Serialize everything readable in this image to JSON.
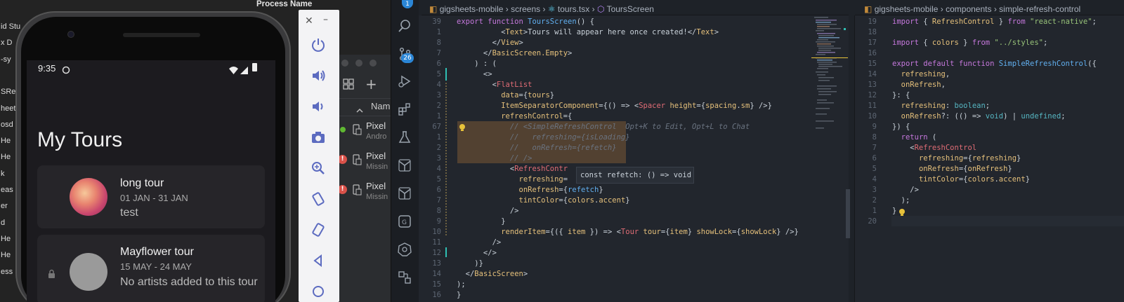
{
  "background_window": {
    "header": "Process Name",
    "rows": [
      "id Stu",
      "x D",
      "-sy",
      "",
      "SRe",
      "heet",
      "osd",
      "He",
      "He",
      "k",
      "eas",
      "er",
      "d",
      "He",
      "He",
      "ess"
    ]
  },
  "device_manager": {
    "column_header": "Name",
    "devices": [
      {
        "name": "Pixel",
        "sub": "Andro",
        "status": "running"
      },
      {
        "name": "Pixel",
        "sub": "Missin",
        "status": "error"
      },
      {
        "name": "Pixel",
        "sub": "Missin",
        "status": "error"
      }
    ]
  },
  "emulator_toolbar": {
    "buttons": [
      "close-icon",
      "minimize-icon",
      "power-icon",
      "volume-up-icon",
      "volume-down-icon",
      "camera-icon",
      "zoom-icon",
      "rotate-left-icon",
      "rotate-right-icon",
      "back-icon",
      "home-icon"
    ]
  },
  "phone": {
    "time": "9:35",
    "title": "My Tours",
    "tours": [
      {
        "title": "long tour",
        "dates": "01 JAN - 31 JAN",
        "desc": "test",
        "avatar": "flower-photo",
        "locked": false
      },
      {
        "title": "Mayflower tour",
        "dates": "15 MAY - 24 MAY",
        "desc": "No artists added to this tour",
        "avatar": "gray-placeholder",
        "locked": true
      }
    ]
  },
  "vscode": {
    "activity_badges": {
      "explorer": "1",
      "source_control": "26"
    },
    "editor1": {
      "breadcrumb": [
        "gigsheets-mobile",
        "screens",
        "tours.tsx",
        "ToursScreen"
      ],
      "hover_tooltip": "const refetch: () => void",
      "lines": [
        {
          "n": "39",
          "h": "<span class=\"k\">export function</span> <span class=\"f\">ToursScreen</span>() {"
        },
        {
          "n": "1",
          "h": "          &lt;<span class=\"y\">Text</span>&gt;Tours will appear here once created!&lt;/<span class=\"y\">Text</span>&gt;"
        },
        {
          "n": "8",
          "h": "        &lt;/<span class=\"y\">View</span>&gt;"
        },
        {
          "n": "7",
          "h": "      &lt;/<span class=\"y\">BasicScreen.Empty</span>&gt;"
        },
        {
          "n": "6",
          "h": "    ) : ("
        },
        {
          "n": "5",
          "h": "      &lt;&gt;"
        },
        {
          "n": "4",
          "h": "        &lt;<span class=\"t\">FlatList</span>"
        },
        {
          "n": "3",
          "h": "          <span class=\"y\">data</span>={<span class=\"y\">tours</span>}"
        },
        {
          "n": "2",
          "h": "          <span class=\"y\">ItemSeparatorComponent</span>={() =&gt; &lt;<span class=\"t\">Spacer</span> <span class=\"y\">height</span>={<span class=\"y\">spacing</span>.<span class=\"y\">sm</span>} /&gt;}"
        },
        {
          "n": "1",
          "h": "          <span class=\"y\">refreshControl</span>={"
        },
        {
          "n": "67",
          "h": "            <span class=\"c\">// &lt;SimpleRefreshControl</span>  <span class=\"c\">Opt+K to Edit, Opt+L to Chat</span>"
        },
        {
          "n": "1",
          "h": "            <span class=\"c\">//   refreshing={isLoading}</span>"
        },
        {
          "n": "2",
          "h": "            <span class=\"c\">//   onRefresh={refetch}</span>"
        },
        {
          "n": "3",
          "h": "            <span class=\"c\">// /&gt;</span>"
        },
        {
          "n": "4",
          "h": "            &lt;<span class=\"t\">RefreshContr</span>"
        },
        {
          "n": "5",
          "h": "              <span class=\"y\">refreshing</span>="
        },
        {
          "n": "6",
          "h": "              <span class=\"y\">onRefresh</span>={<span class=\"f\">refetch</span>}"
        },
        {
          "n": "7",
          "h": "              <span class=\"y\">tintColor</span>={<span class=\"y\">colors</span>.<span class=\"y\">accent</span>}"
        },
        {
          "n": "8",
          "h": "            /&gt;"
        },
        {
          "n": "9",
          "h": "          }"
        },
        {
          "n": "10",
          "h": "          <span class=\"y\">renderItem</span>={({ <span class=\"y\">item</span> }) =&gt; &lt;<span class=\"t\">Tour</span> <span class=\"y\">tour</span>={<span class=\"y\">item</span>} <span class=\"y\">showLock</span>={<span class=\"y\">showLock</span>} /&gt;}"
        },
        {
          "n": "11",
          "h": "        /&gt;"
        },
        {
          "n": "12",
          "h": "      &lt;/&gt;"
        },
        {
          "n": "13",
          "h": "    )}"
        },
        {
          "n": "14",
          "h": "  &lt;/<span class=\"y\">BasicScreen</span>&gt;"
        },
        {
          "n": "15",
          "h": ");"
        },
        {
          "n": "16",
          "h": "}"
        }
      ]
    },
    "editor2": {
      "breadcrumb": [
        "gigsheets-mobile",
        "components",
        "simple-refresh-control"
      ],
      "lines": [
        {
          "n": "19",
          "h": "<span class=\"k\">import</span> { <span class=\"y\">RefreshControl</span> } <span class=\"k\">from</span> <span class=\"s\">\"react-native\"</span>;"
        },
        {
          "n": "18",
          "h": ""
        },
        {
          "n": "17",
          "h": "<span class=\"k\">import</span> { <span class=\"y\">colors</span> } <span class=\"k\">from</span> <span class=\"s\">\"../styles\"</span>;"
        },
        {
          "n": "16",
          "h": ""
        },
        {
          "n": "15",
          "h": "<span class=\"k\">export default function</span> <span class=\"f\">SimpleRefreshControl</span>({"
        },
        {
          "n": "14",
          "h": "  <span class=\"y\">refreshing</span>,"
        },
        {
          "n": "13",
          "h": "  <span class=\"y\">onRefresh</span>,"
        },
        {
          "n": "12",
          "h": "}: {"
        },
        {
          "n": "11",
          "h": "  <span class=\"y\">refreshing</span>: <span class=\"b\">boolean</span>;"
        },
        {
          "n": "10",
          "h": "  <span class=\"y\">onRefresh</span>?: (() =&gt; <span class=\"b\">void</span>) | <span class=\"b\">undefined</span>;"
        },
        {
          "n": "9",
          "h": "}) {"
        },
        {
          "n": "8",
          "h": "  <span class=\"k\">return</span> ("
        },
        {
          "n": "7",
          "h": "    &lt;<span class=\"t\">RefreshControl</span>"
        },
        {
          "n": "6",
          "h": "      <span class=\"y\">refreshing</span>={<span class=\"y\">refreshing</span>}"
        },
        {
          "n": "5",
          "h": "      <span class=\"y\">onRefresh</span>={<span class=\"y\">onRefresh</span>}"
        },
        {
          "n": "4",
          "h": "      <span class=\"y\">tintColor</span>={<span class=\"y\">colors</span>.<span class=\"y\">accent</span>}"
        },
        {
          "n": "3",
          "h": "    /&gt;"
        },
        {
          "n": "2",
          "h": "  );"
        },
        {
          "n": "1",
          "h": "}"
        },
        {
          "n": "20",
          "h": ""
        }
      ]
    }
  }
}
